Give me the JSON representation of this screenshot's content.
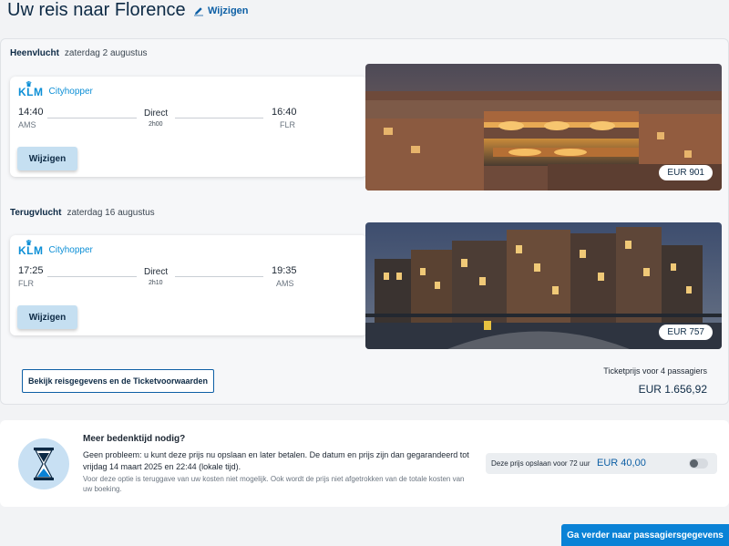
{
  "header": {
    "title": "Uw reis naar Florence",
    "edit_label": "Wijzigen"
  },
  "outbound": {
    "label": "Heenvlucht",
    "date": "zaterdag 2 augustus",
    "airline_logo": "KLM",
    "airline_sub": "Cityhopper",
    "dep_time": "14:40",
    "dep_airport": "AMS",
    "arr_time": "16:40",
    "arr_airport": "FLR",
    "stops": "Direct",
    "duration": "2h00",
    "change_label": "Wijzigen",
    "price": "EUR 901"
  },
  "inbound": {
    "label": "Terugvlucht",
    "date": "zaterdag 16 augustus",
    "airline_logo": "KLM",
    "airline_sub": "Cityhopper",
    "dep_time": "17:25",
    "dep_airport": "FLR",
    "arr_time": "19:35",
    "arr_airport": "AMS",
    "stops": "Direct",
    "duration": "2h10",
    "change_label": "Wijzigen",
    "price": "EUR 757"
  },
  "summary": {
    "details_link": "Bekijk reisgegevens en de Ticketvoorwaarden",
    "total_label": "Ticketprijs voor 4 passagiers",
    "total_value": "EUR 1.656,92"
  },
  "hold": {
    "title": "Meer bedenktijd nodig?",
    "text": "Geen probleem: u kunt deze prijs nu opslaan en later betalen. De datum en prijs zijn dan gegarandeerd tot vrijdag 14 maart 2025 en 22:44 (lokale tijd).",
    "note": "Voor deze optie is teruggave van uw kosten niet mogelijk. Ook wordt de prijs niet afgetrokken van de totale kosten van uw boeking.",
    "option_label": "Deze prijs opslaan voor 72 uur",
    "option_price": "EUR 40,00",
    "toggle_on": false
  },
  "footer": {
    "continue_label": "Ga verder naar passagiersgegevens"
  },
  "colors": {
    "brand_blue": "#0a82d6",
    "klm_blue": "#0d8fd6",
    "dark_navy": "#0d2a45"
  },
  "icons": [
    "pencil-icon",
    "klm-crown-icon",
    "hourglass-icon",
    "toggle-switch"
  ]
}
